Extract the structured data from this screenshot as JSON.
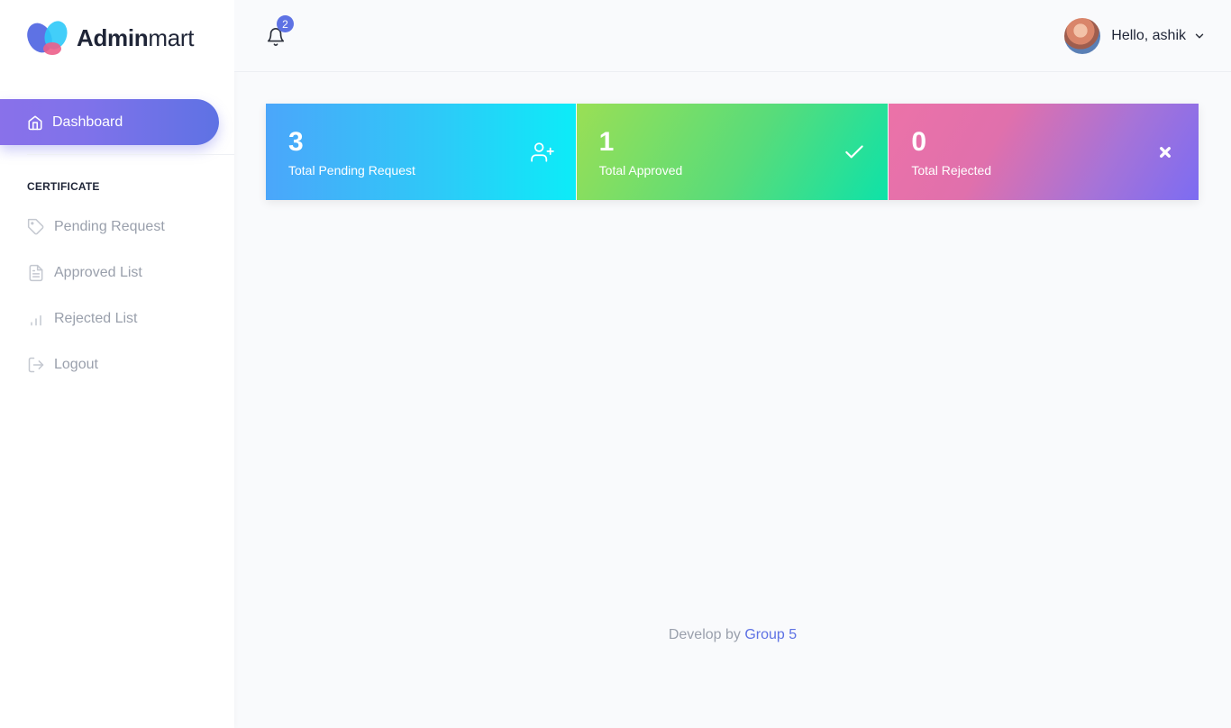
{
  "brand": {
    "name_bold": "Admin",
    "name_light": "mart"
  },
  "sidebar": {
    "active_item": {
      "label": "Dashboard",
      "icon": "home-icon"
    },
    "section_label": "CERTIFICATE",
    "items": [
      {
        "label": "Pending Request",
        "icon": "tag-icon"
      },
      {
        "label": "Approved List",
        "icon": "document-icon"
      },
      {
        "label": "Rejected List",
        "icon": "bar-chart-icon"
      },
      {
        "label": "Logout",
        "icon": "logout-icon"
      }
    ]
  },
  "header": {
    "notifications_count": "2",
    "greeting": "Hello, ashik"
  },
  "stats": [
    {
      "value": "3",
      "label": "Total Pending Request",
      "icon": "user-plus-icon"
    },
    {
      "value": "1",
      "label": "Total Approved",
      "icon": "check-icon"
    },
    {
      "value": "0",
      "label": "Total Rejected",
      "icon": "close-icon"
    }
  ],
  "footer": {
    "prefix": "Develop by",
    "link": "Group 5"
  },
  "colors": {
    "accent": "#5e72e4",
    "text_muted": "#9aa0ac"
  }
}
